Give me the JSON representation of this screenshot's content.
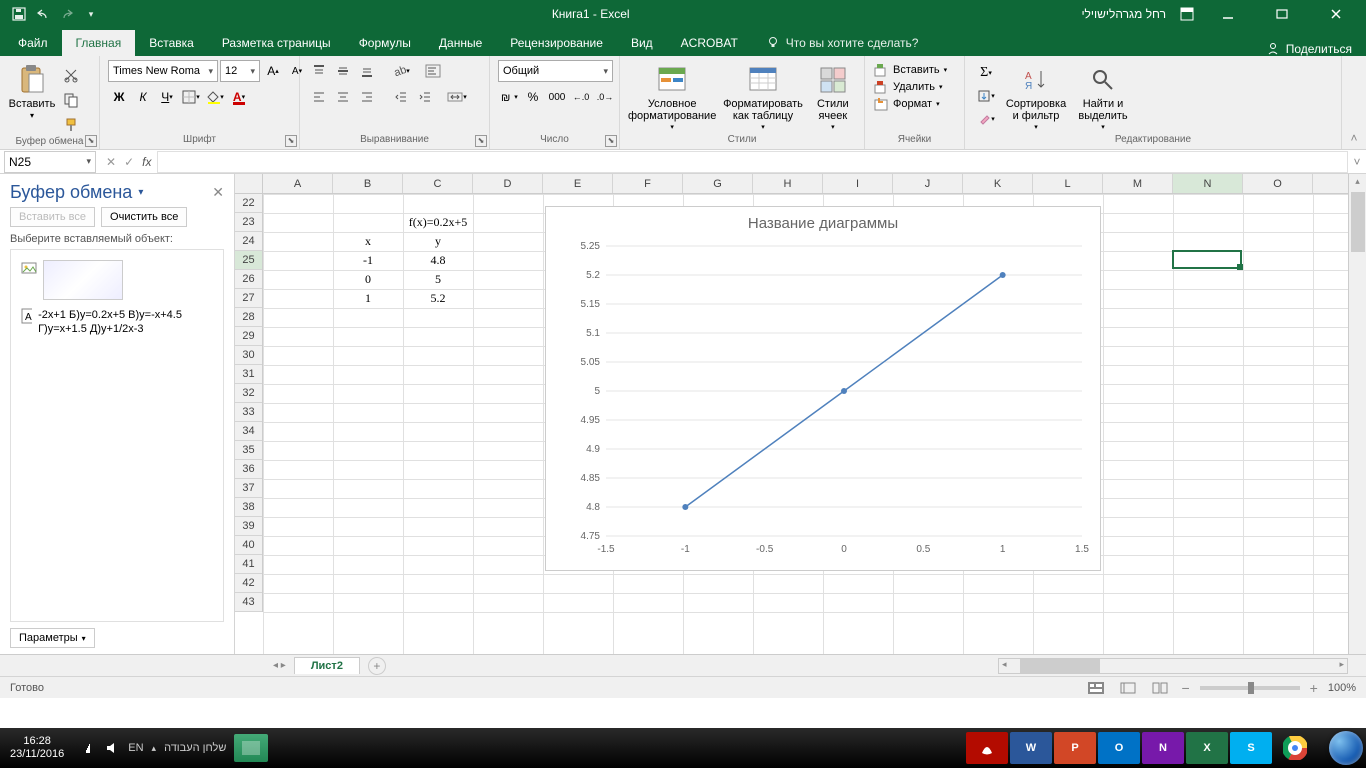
{
  "title": "Книга1  -  Excel",
  "user": "רחל מגרהלישוילי",
  "tabs": [
    "Файл",
    "Главная",
    "Вставка",
    "Разметка страницы",
    "Формулы",
    "Данные",
    "Рецензирование",
    "Вид",
    "ACROBAT"
  ],
  "tellme": "Что вы хотите сделать?",
  "share": "Поделиться",
  "ribbon": {
    "clipboard": {
      "paste": "Вставить",
      "label": "Буфер обмена"
    },
    "font": {
      "name": "Times New Roma",
      "size": "12",
      "label": "Шрифт"
    },
    "align": {
      "label": "Выравнивание"
    },
    "number": {
      "format": "Общий",
      "label": "Число"
    },
    "styles": {
      "cond": "Условное форматирование",
      "table": "Форматировать как таблицу",
      "cell": "Стили ячеек",
      "label": "Стили"
    },
    "cells": {
      "insert": "Вставить",
      "delete": "Удалить",
      "format": "Формат",
      "label": "Ячейки"
    },
    "edit": {
      "sort": "Сортировка и фильтр",
      "find": "Найти и выделить",
      "label": "Редактирование"
    }
  },
  "namebox": "N25",
  "clipboard_pane": {
    "title": "Буфер обмена",
    "paste_all": "Вставить все",
    "clear_all": "Очистить все",
    "hint": "Выберите вставляемый объект:",
    "item_text": "-2x+1 Б)y=0.2x+5 В)y=-x+4.5 Г)y=x+1.5 Д)y+1/2x-3",
    "params": "Параметры"
  },
  "columns": [
    "A",
    "B",
    "C",
    "D",
    "E",
    "F",
    "G",
    "H",
    "I",
    "J",
    "K",
    "L",
    "M",
    "N",
    "O"
  ],
  "rows_start": 22,
  "rows_end": 43,
  "selected_col": "N",
  "selected_row": 25,
  "cell_data": {
    "C23": "f(x)=0.2x+5",
    "B24": "x",
    "C24": "y",
    "B25": "-1",
    "C25": "4.8",
    "B26": "0",
    "C26": "5",
    "B27": "1",
    "C27": "5.2"
  },
  "sheet_tab": "Лист2",
  "status": "Готово",
  "zoom": "100%",
  "taskbar": {
    "time": "16:28",
    "date": "23/11/2016",
    "lang": "EN",
    "desktop": "‏שלחן העבודה"
  },
  "chart_data": {
    "type": "line",
    "title": "Название диаграммы",
    "x": [
      -1,
      0,
      1
    ],
    "y": [
      4.8,
      5,
      5.2
    ],
    "xlim": [
      -1.5,
      1.5
    ],
    "ylim": [
      4.75,
      5.25
    ],
    "xticks": [
      -1.5,
      -1,
      -0.5,
      0,
      0.5,
      1,
      1.5
    ],
    "yticks": [
      4.75,
      4.8,
      4.85,
      4.9,
      4.95,
      5,
      5.05,
      5.1,
      5.15,
      5.2,
      5.25
    ]
  }
}
